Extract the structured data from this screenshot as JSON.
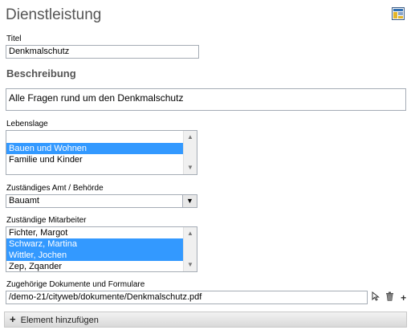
{
  "header": {
    "title": "Dienstleistung",
    "corner_icon": "layout-icon"
  },
  "titel": {
    "label": "Titel",
    "value": "Denkmalschutz"
  },
  "beschreibung": {
    "heading": "Beschreibung",
    "value": "Alle Fragen rund um den Denkmalschutz"
  },
  "lebenslage": {
    "label": "Lebenslage",
    "items": [
      {
        "label": "",
        "selected": false
      },
      {
        "label": "Bauen und Wohnen",
        "selected": true
      },
      {
        "label": "Familie und Kinder",
        "selected": false
      }
    ]
  },
  "amt": {
    "label": "Zuständiges Amt / Behörde",
    "value": "Bauamt"
  },
  "mitarbeiter": {
    "label": "Zuständige Mitarbeiter",
    "items": [
      {
        "label": "Fichter, Margot",
        "selected": false
      },
      {
        "label": "Schwarz, Martina",
        "selected": true
      },
      {
        "label": "Wittler, Jochen",
        "selected": true
      },
      {
        "label": "Zep, Zqander",
        "selected": false
      }
    ]
  },
  "dokumente": {
    "label": "Zugehörige Dokumente und Formulare",
    "value": "/demo-21/cityweb/dokumente/Denkmalschutz.pdf",
    "tools": {
      "pointer": "cursor-icon",
      "trash": "trash-icon",
      "plus": "+"
    }
  },
  "add_element": {
    "plus": "+",
    "label": "Element hinzufügen"
  }
}
